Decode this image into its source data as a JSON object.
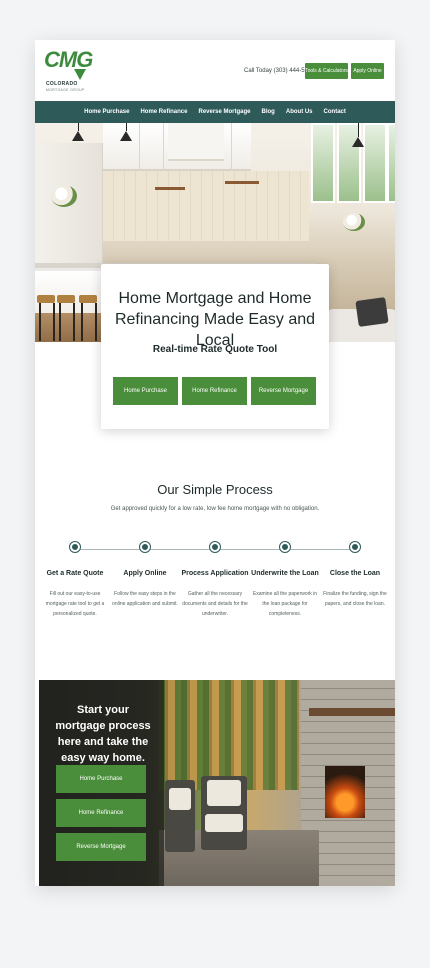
{
  "header": {
    "logo_mark": "CMG",
    "logo_name": "COLORADO",
    "logo_sub": "MORTGAGE GROUP",
    "call_text": "Call Today (303) 444-5251",
    "tools_label": "Tools & Calculators",
    "apply_label": "Apply Online"
  },
  "nav": {
    "items": [
      "Home Purchase",
      "Home Refinance",
      "Reverse Mortgage",
      "Blog",
      "About Us",
      "Contact"
    ]
  },
  "hero": {
    "title": "Home Mortgage and Home Refinancing Made Easy and Local",
    "subtitle": "Real-time Rate Quote Tool",
    "buttons": [
      "Home Purchase",
      "Home Refinance",
      "Reverse Mortgage"
    ]
  },
  "process": {
    "title": "Our Simple Process",
    "subtitle": "Get approved quickly for a low rate, low fee home mortgage with no obligation.",
    "steps": [
      {
        "title": "Get a Rate Quote",
        "desc": "Fill out our easy-to-use mortgage rate tool to get a personalized quote."
      },
      {
        "title": "Apply Online",
        "desc": "Follow the easy steps in the online application and submit."
      },
      {
        "title": "Process Application",
        "desc": "Gather all the necessary documents and details for the underwriter."
      },
      {
        "title": "Underwrite the Loan",
        "desc": "Examine all the paperwork in the loan package for completeness."
      },
      {
        "title": "Close the Loan",
        "desc": "Finalize the funding, sign the papers, and close the loan."
      }
    ]
  },
  "bottom": {
    "title": "Start your mortgage process here and take the easy way home.",
    "buttons": [
      "Home Purchase",
      "Home Refinance",
      "Reverse Mortgage"
    ]
  },
  "colors": {
    "brand_green": "#4a8d3a",
    "nav_teal": "#2f5a5a"
  }
}
